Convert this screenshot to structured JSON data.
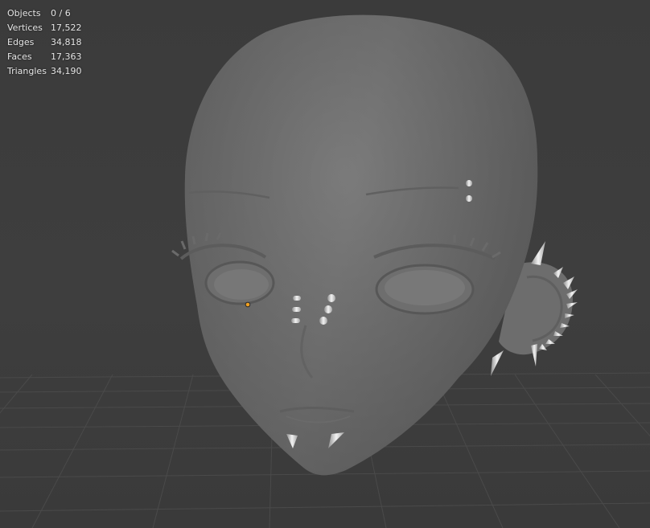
{
  "viewport": {
    "name": "3D Viewport",
    "background_color": "#3d3d3d",
    "model_color": "#7a7a7a"
  },
  "stats": {
    "rows": [
      {
        "label": "Objects",
        "value": "0 / 6"
      },
      {
        "label": "Vertices",
        "value": "17,522"
      },
      {
        "label": "Edges",
        "value": "34,818"
      },
      {
        "label": "Faces",
        "value": "17,363"
      },
      {
        "label": "Triangles",
        "value": "34,190"
      }
    ]
  },
  "scene": {
    "model": "stylized-head-mesh",
    "accessories": [
      "eyebrow-piercing",
      "nose-studs",
      "ear-spikes",
      "lip-spikes"
    ],
    "origin_marker_color": "#f0a020"
  }
}
